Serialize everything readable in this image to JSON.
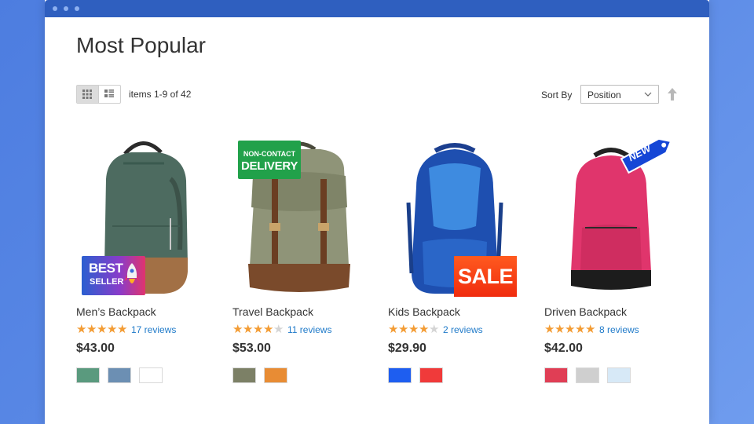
{
  "page": {
    "title": "Most Popular",
    "items_count": "items 1-9 of 42",
    "sort_label": "Sort By",
    "sort_value": "Position",
    "view_modes": [
      "grid-icon",
      "list-icon"
    ]
  },
  "colors": {
    "accent_blue": "#2f5fbf",
    "star": "#f39c34",
    "link": "#1f7ac9"
  },
  "products": [
    {
      "name": "Men’s Backpack",
      "rating": 5,
      "reviews": "17 reviews",
      "price": "$43.00",
      "swatches": [
        "#5a9a7e",
        "#6c8fb3",
        "#ffffff"
      ],
      "badge": {
        "line1": "BEST",
        "line2": "SELLER"
      }
    },
    {
      "name": "Travel Backpack",
      "rating": 4,
      "reviews": "11 reviews",
      "price": "$53.00",
      "swatches": [
        "#7c8066",
        "#e88c34"
      ],
      "badge": {
        "line1": "NON-CONTACT",
        "line2": "DELIVERY"
      }
    },
    {
      "name": "Kids Backpack",
      "rating": 4,
      "reviews": "2 reviews",
      "price": "$29.90",
      "swatches": [
        "#1e5ef0",
        "#f03a3a"
      ],
      "badge": {
        "text": "SALE"
      }
    },
    {
      "name": "Driven Backpack",
      "rating": 5,
      "reviews": "8 reviews",
      "price": "$42.00",
      "swatches": [
        "#e03e55",
        "#cfcfcf",
        "#d7e9f7"
      ],
      "badge": {
        "text": "NEW"
      }
    }
  ]
}
